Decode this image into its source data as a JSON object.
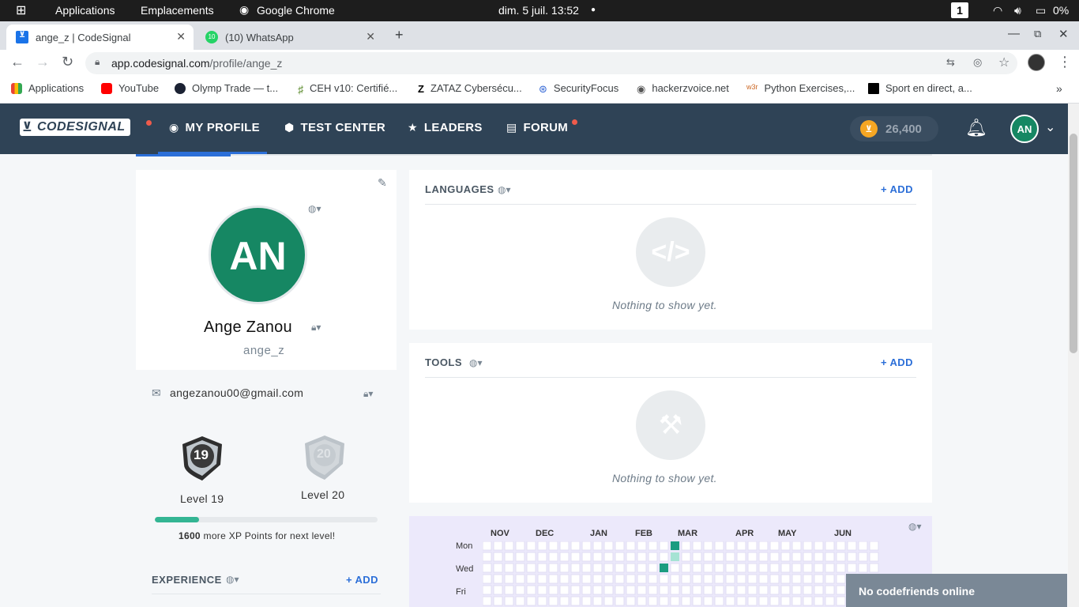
{
  "os": {
    "apps": "Applications",
    "places": "Emplacements",
    "active_app": "Google Chrome",
    "datetime": "dim. 5 juil.  13:52",
    "workspace": "1",
    "battery": "0%"
  },
  "tabs": [
    {
      "title": "ange_z | CodeSignal"
    },
    {
      "title": "(10) WhatsApp",
      "badge": "10"
    }
  ],
  "address": {
    "url_host": "app.codesignal.com",
    "url_path": "/profile/ange_z"
  },
  "bookmarks": [
    {
      "label": "Applications"
    },
    {
      "label": "YouTube"
    },
    {
      "label": "Olymp Trade — t..."
    },
    {
      "label": "CEH v10: Certifié..."
    },
    {
      "label": "ZATAZ Cybersécu..."
    },
    {
      "label": "SecurityFocus"
    },
    {
      "label": "hackerzvoice.net"
    },
    {
      "label": "Python Exercises,..."
    },
    {
      "label": "Sport en direct, a..."
    }
  ],
  "nav": {
    "logo": "CODESIGNAL",
    "items": [
      {
        "label": "MY PROFILE"
      },
      {
        "label": "TEST CENTER"
      },
      {
        "label": "LEADERS"
      },
      {
        "label": "FORUM"
      }
    ],
    "coins": "26,400",
    "avatar": "AN"
  },
  "profile": {
    "initials": "AN",
    "name": "Ange Zanou",
    "username": "ange_z",
    "email": "angezanou00@gmail.com",
    "current_level": {
      "num": "19",
      "label": "Level 19"
    },
    "next_level": {
      "num": "20",
      "label": "Level 20"
    },
    "progress_fraction": 0.2,
    "xp_needed": "1600",
    "xp_text": " more XP Points for next level!"
  },
  "experience": {
    "title": "EXPERIENCE",
    "add": "+ ADD"
  },
  "languages": {
    "title": "LANGUAGES",
    "add": "+ ADD",
    "empty": "Nothing to show yet."
  },
  "tools": {
    "title": "TOOLS",
    "add": "+ ADD",
    "empty": "Nothing to show yet."
  },
  "activity": {
    "months": [
      "NOV",
      "DEC",
      "JAN",
      "FEB",
      "MAR",
      "APR",
      "MAY",
      "JUN"
    ],
    "days": [
      "Mon",
      "Wed",
      "Fri"
    ]
  },
  "toast": "No codefriends online",
  "colors": {
    "nav": "#2f4356",
    "accent": "#2c6fd8",
    "avatar": "#168763",
    "notify": "#ef5b4b",
    "progress": "#33b593",
    "heat": "#1a9c80"
  }
}
